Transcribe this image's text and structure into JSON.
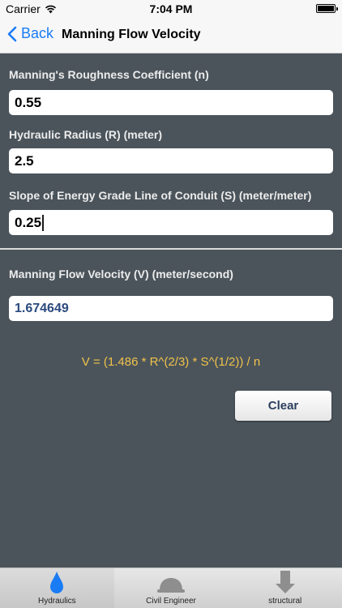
{
  "status": {
    "carrier": "Carrier",
    "time": "7:04 PM"
  },
  "nav": {
    "back_label": "Back",
    "title": "Manning Flow Velocity"
  },
  "inputs": [
    {
      "label": "Manning's Roughness Coefficient (n)",
      "value": "0.55"
    },
    {
      "label": "Hydraulic Radius (R) (meter)",
      "value": "2.5"
    },
    {
      "label": "Slope of Energy Grade Line of Conduit (S) (meter/meter)",
      "value": "0.25"
    }
  ],
  "result": {
    "label": "Manning Flow Velocity (V) (meter/second)",
    "value": "1.674649"
  },
  "formula": "V = (1.486 * R^(2/3) * S^(1/2)) / n",
  "clear_label": "Clear",
  "tabs": [
    {
      "label": "Hydraulics",
      "icon": "water-drop-icon",
      "active": true
    },
    {
      "label": "Civil Engineer",
      "icon": "hard-hat-icon",
      "active": false
    },
    {
      "label": "structural",
      "icon": "building-icon",
      "active": false
    }
  ],
  "colors": {
    "background": "#4b545b",
    "accent": "#1a7cf5",
    "formula": "#f0c24a",
    "result_text": "#2b4a7e",
    "active_tab_icon": "#1a7cf5"
  }
}
